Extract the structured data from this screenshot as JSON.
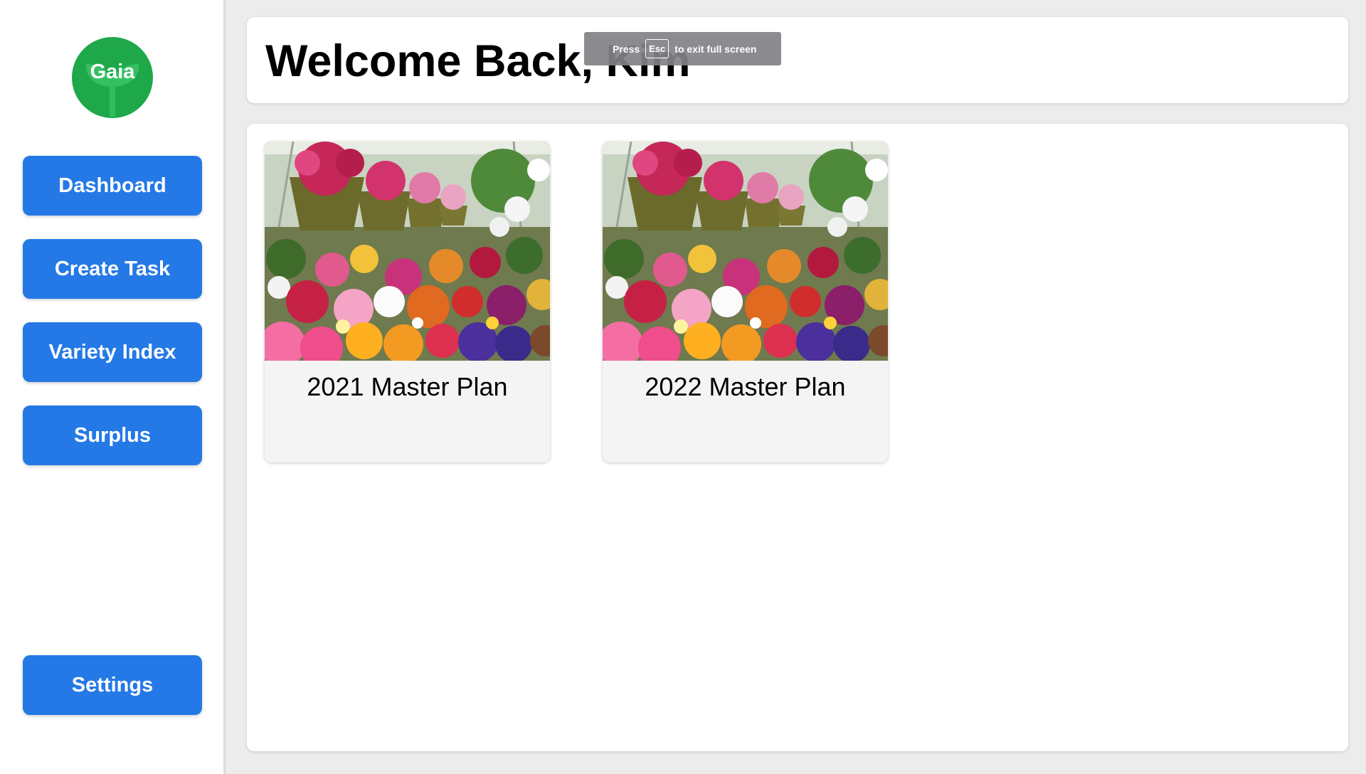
{
  "app": {
    "logo_text": "Gaia",
    "brand_color": "#1fa84a",
    "accent_color": "#2479e6"
  },
  "sidebar": {
    "items": [
      {
        "label": "Dashboard"
      },
      {
        "label": "Create Task"
      },
      {
        "label": "Variety Index"
      },
      {
        "label": "Surplus"
      }
    ],
    "settings_label": "Settings"
  },
  "header": {
    "title": "Welcome Back, Kim"
  },
  "fullscreen_toast": {
    "prefix": "Press",
    "key": "Esc",
    "suffix": "to exit full screen"
  },
  "plans": [
    {
      "title": "2021 Master Plan",
      "image": "flower-greenhouse-photo"
    },
    {
      "title": "2022 Master Plan",
      "image": "flower-greenhouse-photo"
    }
  ]
}
